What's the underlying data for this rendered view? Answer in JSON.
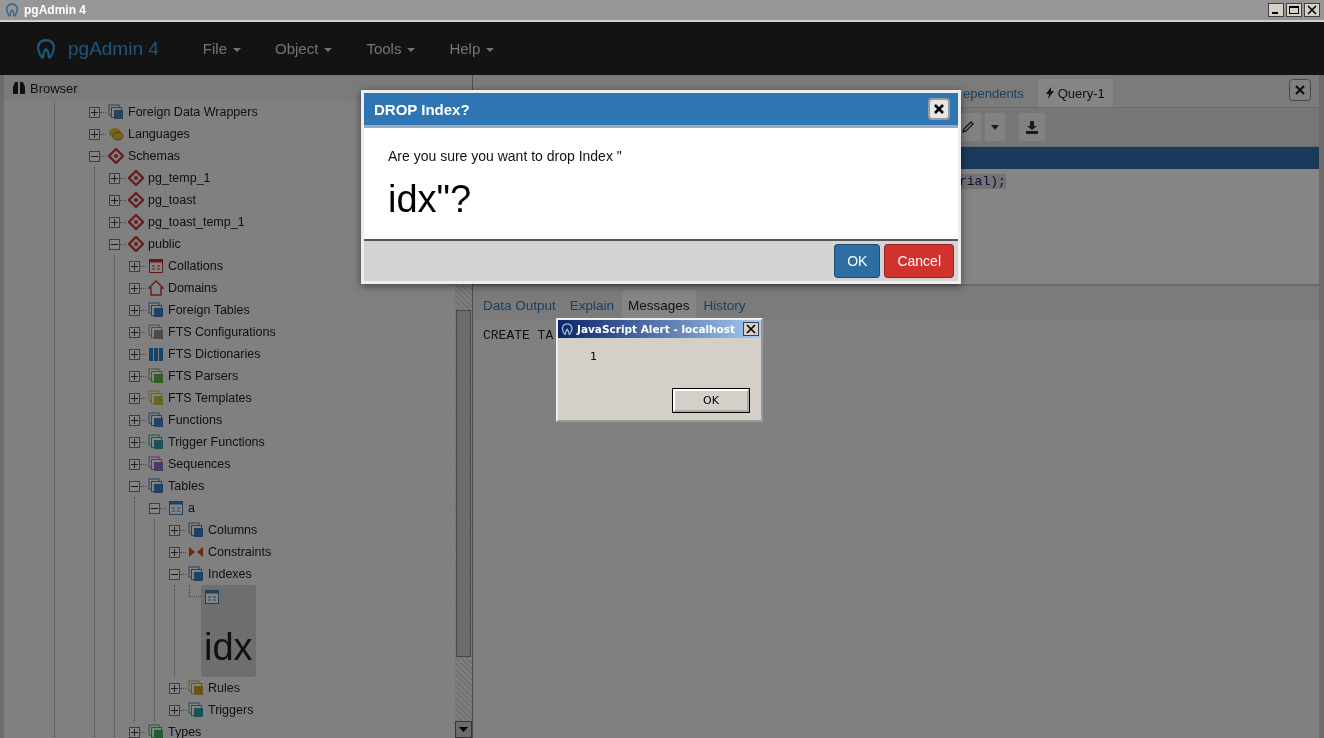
{
  "window": {
    "title": "pgAdmin 4"
  },
  "navbar": {
    "brand": "pgAdmin 4",
    "menus": [
      "File",
      "Object",
      "Tools",
      "Help"
    ]
  },
  "browser": {
    "title": "Browser",
    "tree": [
      {
        "label": "Foreign Data Wrappers",
        "kind": "fdw",
        "expanded": false,
        "selected": false
      },
      {
        "label": "Languages",
        "kind": "language",
        "expanded": false,
        "selected": false
      },
      {
        "label": "Schemas",
        "kind": "schemas",
        "expanded": true,
        "selected": false,
        "children": [
          {
            "label": "pg_temp_1",
            "kind": "schema",
            "expanded": false,
            "selected": false
          },
          {
            "label": "pg_toast",
            "kind": "schema",
            "expanded": false,
            "selected": false
          },
          {
            "label": "pg_toast_temp_1",
            "kind": "schema",
            "expanded": false,
            "selected": false
          },
          {
            "label": "public",
            "kind": "schema",
            "expanded": true,
            "selected": false,
            "children": [
              {
                "label": "Collations",
                "kind": "collation",
                "expanded": false,
                "selected": false
              },
              {
                "label": "Domains",
                "kind": "domain",
                "expanded": false,
                "selected": false
              },
              {
                "label": "Foreign Tables",
                "kind": "foreign-table",
                "expanded": false,
                "selected": false
              },
              {
                "label": "FTS Configurations",
                "kind": "fts-config",
                "expanded": false,
                "selected": false
              },
              {
                "label": "FTS Dictionaries",
                "kind": "fts-dict",
                "expanded": false,
                "selected": false
              },
              {
                "label": "FTS Parsers",
                "kind": "fts-parser",
                "expanded": false,
                "selected": false
              },
              {
                "label": "FTS Templates",
                "kind": "fts-template",
                "expanded": false,
                "selected": false
              },
              {
                "label": "Functions",
                "kind": "function",
                "expanded": false,
                "selected": false
              },
              {
                "label": "Trigger Functions",
                "kind": "trigger-function",
                "expanded": false,
                "selected": false
              },
              {
                "label": "Sequences",
                "kind": "sequence",
                "expanded": false,
                "selected": false
              },
              {
                "label": "Tables",
                "kind": "tables",
                "expanded": true,
                "selected": false,
                "children": [
                  {
                    "label": "a",
                    "kind": "table",
                    "expanded": true,
                    "selected": false,
                    "children": [
                      {
                        "label": "Columns",
                        "kind": "columns",
                        "expanded": false,
                        "selected": false
                      },
                      {
                        "label": "Constraints",
                        "kind": "constraints",
                        "expanded": false,
                        "selected": false
                      },
                      {
                        "label": "Indexes",
                        "kind": "indexes",
                        "expanded": true,
                        "selected": false,
                        "children": [
                          {
                            "label": "idx",
                            "kind": "index",
                            "selected": true,
                            "large": true
                          }
                        ]
                      },
                      {
                        "label": "Rules",
                        "kind": "rules",
                        "expanded": false,
                        "selected": false
                      },
                      {
                        "label": "Triggers",
                        "kind": "triggers",
                        "expanded": false,
                        "selected": false
                      }
                    ]
                  }
                ]
              },
              {
                "label": "Types",
                "kind": "types",
                "expanded": false,
                "selected": false
              }
            ]
          }
        ]
      }
    ]
  },
  "query_panel": {
    "tabs": [
      {
        "label": "ependents",
        "kind": "plain",
        "selected": false
      },
      {
        "label": "Query-1",
        "kind": "query",
        "selected": true
      }
    ],
    "code_line": "rial);",
    "result_tabs": [
      {
        "label": "Data Output",
        "selected": false
      },
      {
        "label": "Explain",
        "selected": false
      },
      {
        "label": "Messages",
        "selected": true
      },
      {
        "label": "History",
        "selected": false
      }
    ],
    "message": "CREATE TA"
  },
  "dialog": {
    "title": "DROP Index?",
    "message": "Are you sure you want to drop Index \"",
    "name_text": "idx\"?",
    "buttons": [
      {
        "label": "OK",
        "kind": "primary"
      },
      {
        "label": "Cancel",
        "kind": "danger"
      }
    ]
  },
  "alert": {
    "title": "JavaScript Alert - localhost",
    "message": "1",
    "button": "OK"
  }
}
